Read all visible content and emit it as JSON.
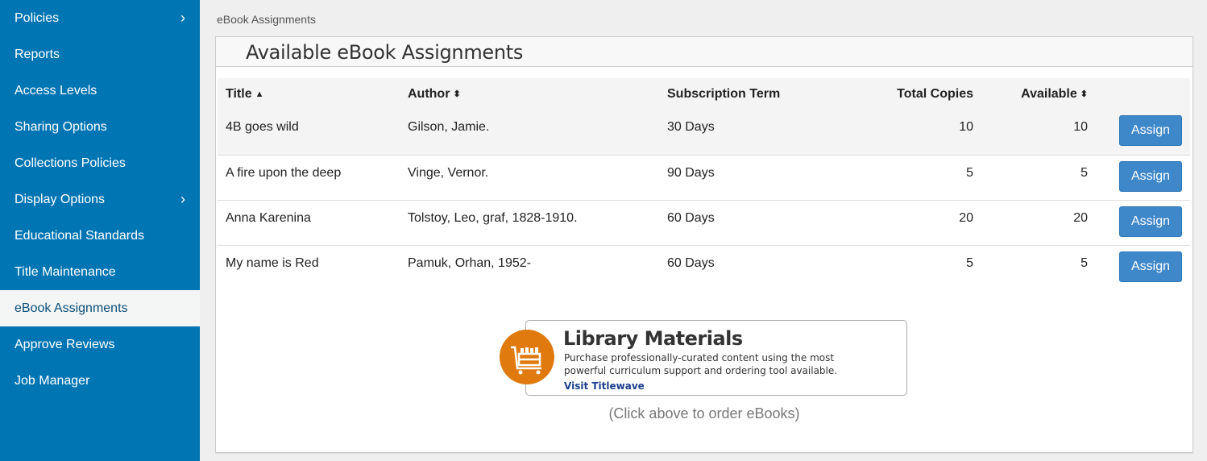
{
  "sidebar": {
    "items": [
      {
        "label": "Policies",
        "has_submenu": true
      },
      {
        "label": "Reports"
      },
      {
        "label": "Access Levels"
      },
      {
        "label": "Sharing Options"
      },
      {
        "label": "Collections Policies"
      },
      {
        "label": "Display Options",
        "has_submenu": true
      },
      {
        "label": "Educational Standards"
      },
      {
        "label": "Title Maintenance"
      },
      {
        "label": "eBook Assignments",
        "active": true
      },
      {
        "label": "Approve Reviews"
      },
      {
        "label": "Job Manager"
      }
    ],
    "chevron": "›"
  },
  "breadcrumb": "eBook Assignments",
  "panel": {
    "title": "Available eBook Assignments"
  },
  "table": {
    "columns": [
      {
        "label": "Title",
        "sort_icon": "▲"
      },
      {
        "label": "Author",
        "sort_icon": "⬍"
      },
      {
        "label": "Subscription Term"
      },
      {
        "label": "Total Copies"
      },
      {
        "label": "Available",
        "sort_icon": "⬍"
      },
      {
        "label": ""
      }
    ],
    "rows": [
      {
        "title": "4B goes wild",
        "author": "Gilson, Jamie.",
        "term": "30 Days",
        "total": "10",
        "available": "10",
        "action": "Assign"
      },
      {
        "title": "A fire upon the deep",
        "author": "Vinge, Vernor.",
        "term": "90 Days",
        "total": "5",
        "available": "5",
        "action": "Assign"
      },
      {
        "title": "Anna Karenina",
        "author": "Tolstoy, Leo, graf, 1828-1910.",
        "term": "60 Days",
        "total": "20",
        "available": "20",
        "action": "Assign"
      },
      {
        "title": "My name is Red",
        "author": "Pamuk, Orhan, 1952-",
        "term": "60 Days",
        "total": "5",
        "available": "5",
        "action": "Assign"
      }
    ]
  },
  "promo": {
    "icon": "shopping-cart-icon",
    "title": "Library Materials",
    "description_line1": "Purchase professionally-curated content using the most",
    "description_line2": "powerful curriculum support and ordering tool available.",
    "link": "Visit Titlewave",
    "caption": "(Click above to order eBooks)"
  },
  "colors": {
    "sidebar_bg": "#0075b3",
    "active_item_bg": "#f4f5f5",
    "button": "#3e87c9",
    "promo_orange": "#e07a0f",
    "link": "#1c3f8c"
  }
}
